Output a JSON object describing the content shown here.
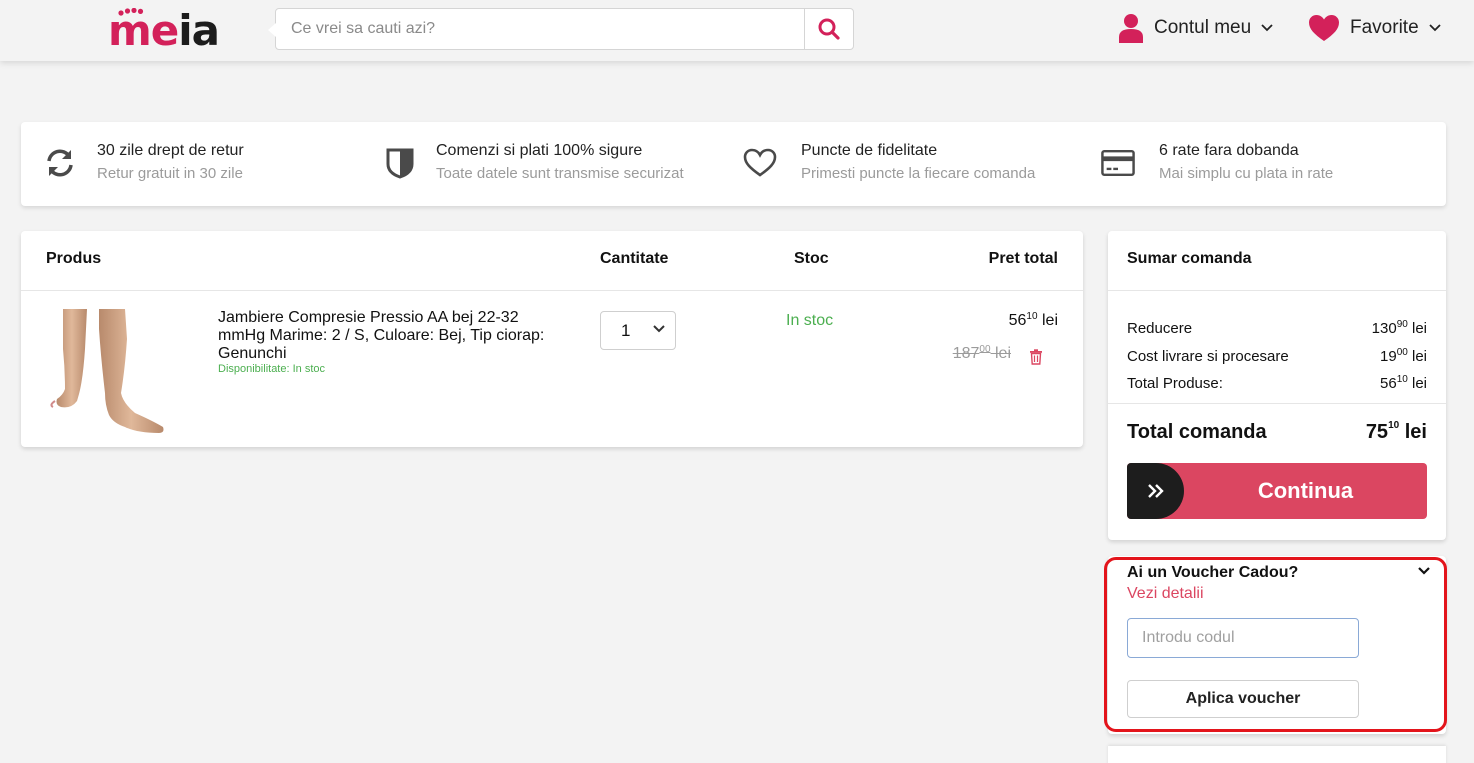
{
  "header": {
    "logo_letter_m": "m",
    "logo_letter_e": "e",
    "logo_letters_ia": "ia",
    "search_placeholder": "Ce vrei sa cauti azi?",
    "account_label": "Contul meu",
    "favorites_label": "Favorite"
  },
  "benefits": [
    {
      "title": "30 zile drept de retur",
      "subtitle": "Retur gratuit in 30 zile",
      "icon": "refresh-icon"
    },
    {
      "title": "Comenzi si plati 100% sigure",
      "subtitle": "Toate datele sunt transmise securizat",
      "icon": "shield-icon"
    },
    {
      "title": "Puncte de fidelitate",
      "subtitle": "Primesti puncte la fiecare comanda",
      "icon": "heart-outline-icon"
    },
    {
      "title": "6 rate fara dobanda",
      "subtitle": "Mai simplu cu plata in rate",
      "icon": "credit-card-icon"
    }
  ],
  "cart": {
    "col_product": "Produs",
    "col_quantity": "Cantitate",
    "col_stock": "Stoc",
    "col_total": "Pret total",
    "item": {
      "name": "Jambiere Compresie Pressio AA bej 22-32 mmHg Marime: 2 / S, Culoare: Bej, Tip ciorap: Genunchi",
      "availability": "Disponibilitate: In stoc",
      "quantity": "1",
      "stock": "In stoc",
      "price_int": "56",
      "price_dec": "10",
      "old_price_int": "187",
      "old_price_dec": "00",
      "currency": "lei"
    }
  },
  "summary": {
    "title": "Sumar comanda",
    "rows": [
      {
        "label": "Reducere",
        "int": "130",
        "dec": "90",
        "currency": "lei"
      },
      {
        "label": "Cost livrare si procesare",
        "int": "19",
        "dec": "00",
        "currency": "lei"
      },
      {
        "label": "Total Produse:",
        "int": "56",
        "dec": "10",
        "currency": "lei"
      }
    ],
    "total_label": "Total comanda",
    "total_int": "75",
    "total_dec": "10",
    "total_currency": "lei",
    "continue_label": "Continua"
  },
  "voucher": {
    "title": "Ai un Voucher Cadou?",
    "details_link": "Vezi detalii",
    "input_placeholder": "Introdu codul",
    "apply_label": "Aplica voucher"
  },
  "colors": {
    "brand": "#d3215a",
    "accent": "#db4661",
    "in_stock": "#4caf50",
    "highlight": "#e3141b"
  }
}
